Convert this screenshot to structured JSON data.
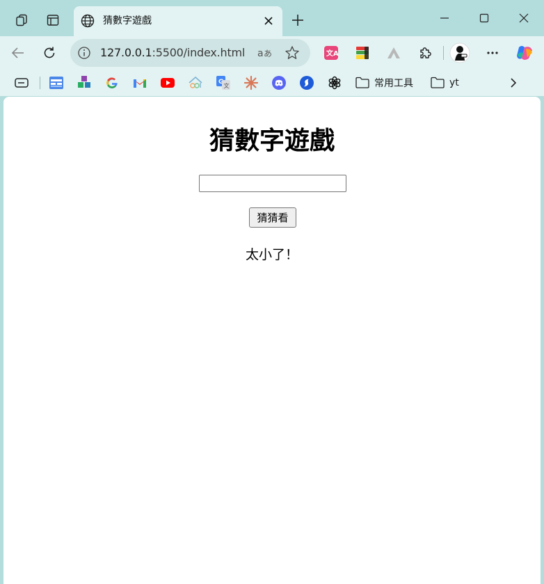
{
  "browser": {
    "tab": {
      "title": "猜數字遊戲"
    },
    "address_bar": {
      "host": "127.0.0.1",
      "path": ":5500/index.html"
    },
    "bookmarks": {
      "folders": [
        {
          "label": "常用工具"
        },
        {
          "label": "yt"
        }
      ]
    },
    "colors": {
      "frame": "#b3dcdc",
      "toolbar": "#e3f3f3",
      "omnibox": "#cfe4e4"
    }
  },
  "page": {
    "title": "猜數字遊戲",
    "input": {
      "value": "",
      "placeholder": ""
    },
    "guess_button": "猜猜看",
    "result": "太小了！"
  }
}
